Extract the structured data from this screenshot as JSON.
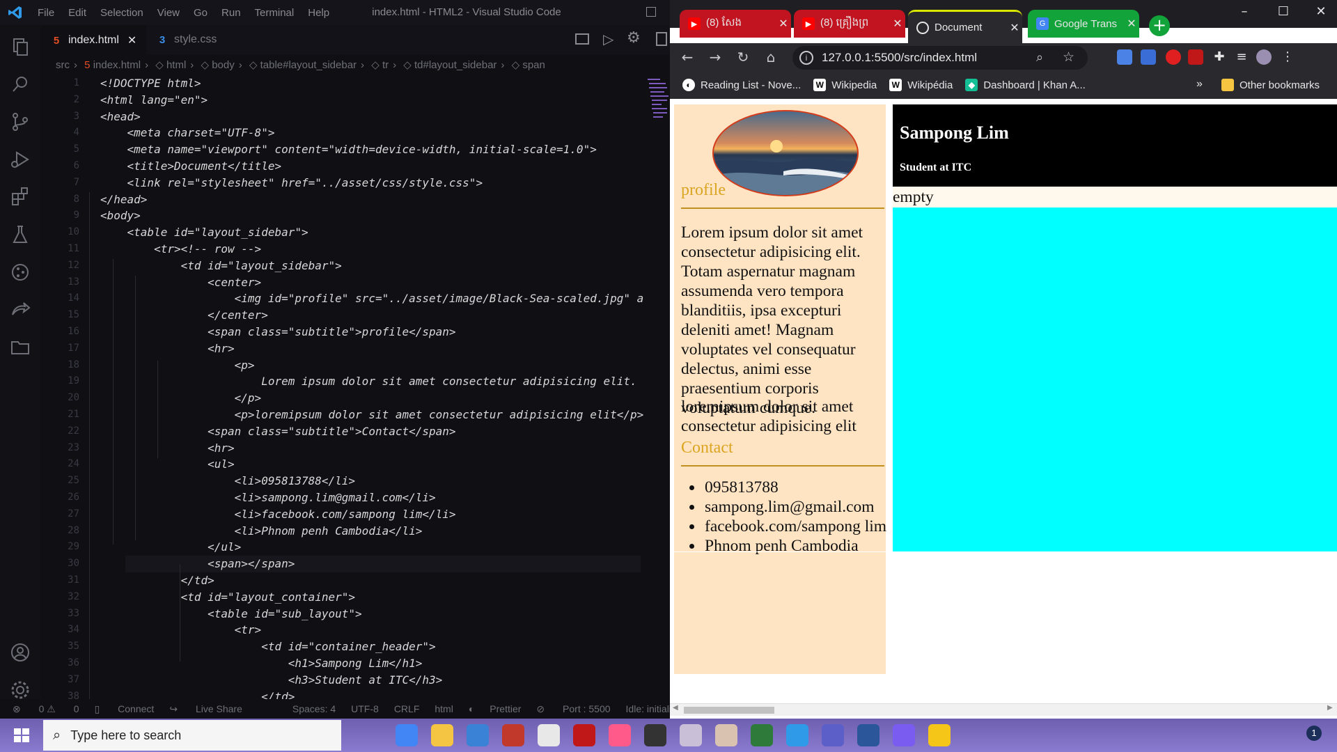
{
  "vscode": {
    "menu": [
      "File",
      "Edit",
      "Selection",
      "View",
      "Go",
      "Run",
      "Terminal",
      "Help"
    ],
    "window_title": "index.html - HTML2 - Visual Studio Code",
    "tabs": [
      {
        "label": "index.html",
        "active": true
      },
      {
        "label": "style.css",
        "active": false
      }
    ],
    "breadcrumb": [
      "src",
      "index.html",
      "html",
      "body",
      "table#layout_sidebar",
      "tr",
      "td#layout_sidebar",
      "span"
    ],
    "line_numbers": [
      "1",
      "2",
      "3",
      "4",
      "5",
      "6",
      "7",
      "8",
      "9",
      "10",
      "11",
      "12",
      "13",
      "14",
      "15",
      "16",
      "17",
      "18",
      "19",
      "20",
      "21",
      "22",
      "23",
      "24",
      "25",
      "26",
      "27",
      "28",
      "29",
      "30",
      "31",
      "32",
      "33",
      "34",
      "35",
      "36",
      "37",
      "38"
    ],
    "code_lines": [
      "<!DOCTYPE html>",
      "<html lang=\"en\">",
      "<head>",
      "    <meta charset=\"UTF-8\">",
      "    <meta name=\"viewport\" content=\"width=device-width, initial-scale=1.0\">",
      "    <title>Document</title>",
      "    <link rel=\"stylesheet\" href=\"../asset/css/style.css\">",
      "</head>",
      "<body>",
      "    <table id=\"layout_sidebar\">",
      "        <tr><!-- row -->",
      "            <td id=\"layout_sidebar\">",
      "                <center>",
      "                    <img id=\"profile\" src=\"../asset/image/Black-Sea-scaled.jpg\" a",
      "                </center>",
      "                <span class=\"subtitle\">profile</span>",
      "                <hr>",
      "                    <p>",
      "                        Lorem ipsum dolor sit amet consectetur adipisicing elit.",
      "                    </p>",
      "                    <p>loremipsum dolor sit amet consectetur adipisicing elit</p>",
      "                <span class=\"subtitle\">Contact</span>",
      "                <hr>",
      "                <ul>",
      "                    <li>095813788</li>",
      "                    <li>sampong.lim@gmail.com</li>",
      "                    <li>facebook.com/sampong lim</li>",
      "                    <li>Phnom penh Cambodia</li>",
      "                </ul>",
      "                <span></span>",
      "            </td>",
      "            <td id=\"layout_container\">",
      "                <table id=\"sub_layout\">",
      "                    <tr>",
      "                        <td id=\"container_header\">",
      "                            <h1>Sampong Lim</h1>",
      "                            <h3>Student at ITC</h3>",
      "                        </td>"
    ],
    "status": {
      "problems": "0",
      "warnings": "0",
      "connect": "Connect",
      "live_share": "Live Share",
      "spaces": "Spaces: 4",
      "encoding": "UTF-8",
      "eol": "CRLF",
      "language": "html",
      "prettier": "Prettier",
      "port": "Port : 5500",
      "idle": "Idle: initializing"
    }
  },
  "chrome": {
    "tabs": [
      {
        "label": "(8) សែង",
        "color": "#c21420"
      },
      {
        "label": "(8) គ្រឿងព្រ",
        "color": "#c21420"
      },
      {
        "label": "Document",
        "color": "#1f1f23"
      },
      {
        "label": "Google Trans",
        "color": "#12a33a"
      }
    ],
    "url": "127.0.0.1:5500/src/index.html",
    "bookmarks": [
      "Reading List - Nove...",
      "Wikipedia",
      "Wikipédia",
      "Dashboard | Khan A..."
    ],
    "other_bookmarks": "Other bookmarks",
    "overflow": "»"
  },
  "page": {
    "profile_subtitle": "profile",
    "paragraph1": "Lorem ipsum dolor sit amet consectetur adipisicing elit. Totam aspernatur magnam assumenda vero tempora blanditiis, ipsa excepturi deleniti amet! Magnam voluptates vel consequatur delectus, animi esse praesentium corporis voluptatum cumque.",
    "paragraph2": "loremipsum dolor sit amet consectetur adipisicing elit",
    "contact_subtitle": "Contact",
    "contacts": [
      "095813788",
      "sampong.lim@gmail.com",
      "facebook.com/sampong lim",
      "Phnom penh Cambodia"
    ],
    "header_name": "Sampong Lim",
    "header_role": "Student at ITC",
    "empty_label": "empty",
    "colors": {
      "sidebar": "#ffe4c4",
      "subtitle": "#daa520",
      "header": "#000000",
      "container": "#00ffff"
    }
  },
  "taskbar": {
    "search_placeholder": "Type here to search",
    "notification_count": "1",
    "apps": [
      "chrome-icon",
      "file-explorer-icon",
      "mail-icon",
      "game-icon",
      "store-icon",
      "acrobat-icon",
      "itunes-icon",
      "media-icon",
      "game2-icon",
      "game3-icon",
      "web-icon",
      "vscode-icon",
      "teams-icon",
      "word-icon",
      "messenger-icon",
      "beeper-icon"
    ]
  }
}
